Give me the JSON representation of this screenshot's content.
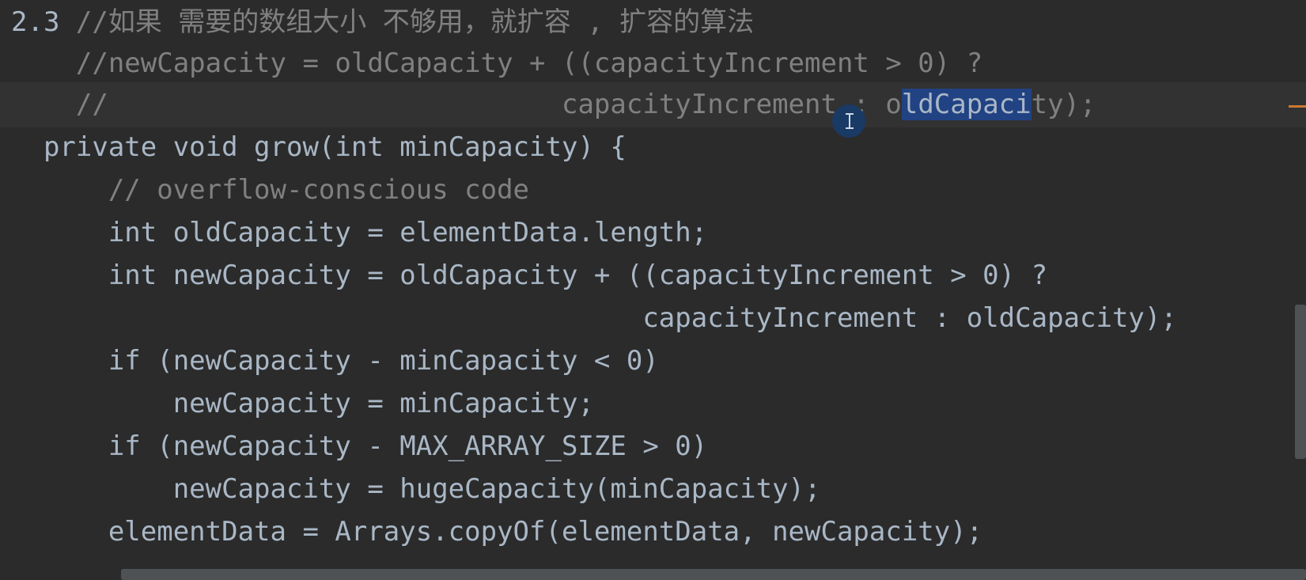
{
  "editor": {
    "lines": [
      {
        "id": "l0",
        "prefix": "2.3 ",
        "text": "//如果 需要的数组大小 不够用，就扩容 , 扩容的算法"
      },
      {
        "id": "l1",
        "text": "    //newCapacity = oldCapacity + ((capacityIncrement > 0) ?"
      },
      {
        "id": "l2",
        "pre": "    //                            capacityIncrement : o",
        "selected": "ldCapaci",
        "post": "ty);"
      },
      {
        "id": "l3",
        "text": "  private void grow(int minCapacity) {"
      },
      {
        "id": "l4",
        "text": "      // overflow-conscious code"
      },
      {
        "id": "l5",
        "text": "      int oldCapacity = elementData.length;"
      },
      {
        "id": "l6",
        "text": "      int newCapacity = oldCapacity + ((capacityIncrement > 0) ?"
      },
      {
        "id": "l7",
        "text": "                                       capacityIncrement : oldCapacity);"
      },
      {
        "id": "l8",
        "text": "      if (newCapacity - minCapacity < 0)"
      },
      {
        "id": "l9",
        "text": "          newCapacity = minCapacity;"
      },
      {
        "id": "l10",
        "text": "      if (newCapacity - MAX_ARRAY_SIZE > 0)"
      },
      {
        "id": "l11",
        "text": "          newCapacity = hugeCapacity(minCapacity);"
      },
      {
        "id": "l12",
        "text": "      elementData = Arrays.copyOf(elementData, newCapacity);"
      }
    ]
  },
  "colors": {
    "background": "#2b2b2b",
    "current_line": "#323232",
    "text": "#a9b7c6",
    "comment": "#808080",
    "selection": "#214283",
    "scrollbar": "#4e5254"
  },
  "icons": {
    "cursor": "text-cursor-icon"
  }
}
